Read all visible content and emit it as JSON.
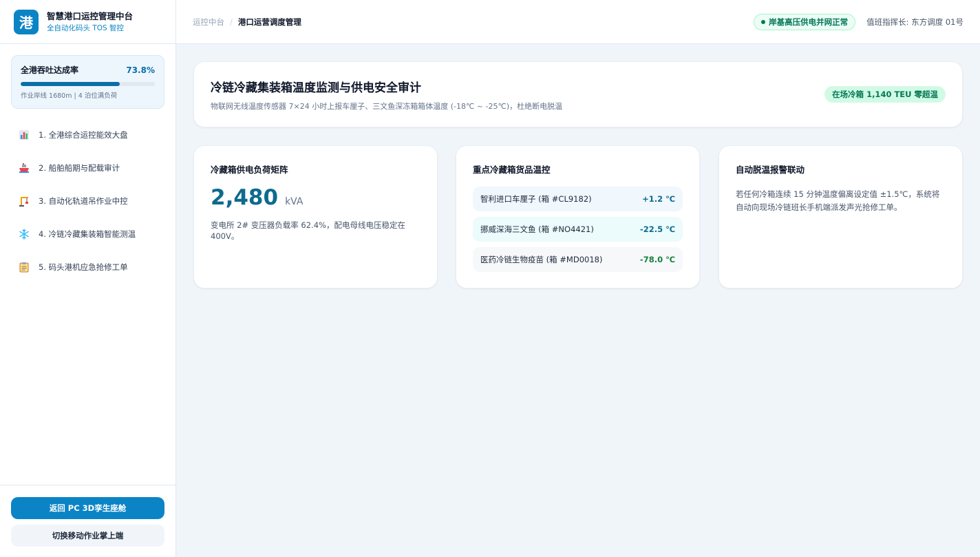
{
  "brand": {
    "logo": "港",
    "title": "智慧港口运控管理中台",
    "subtitle": "全自动化码头 TOS 智控"
  },
  "kpi": {
    "label": "全港吞吐达成率",
    "value": "73.8%",
    "progress": 73.8,
    "note": "作业岸线 1680m | 4 泊位满负荷"
  },
  "nav": [
    {
      "label": "1. 全港综合运控能效大盘",
      "icon": "bar-chart-icon"
    },
    {
      "label": "2. 船舶船期与配载审计",
      "icon": "ship-icon"
    },
    {
      "label": "3. 自动化轨道吊作业中控",
      "icon": "crane-icon"
    },
    {
      "label": "4. 冷链冷藏集装箱智能测温",
      "icon": "snowflake-icon"
    },
    {
      "label": "5. 码头港机应急抢修工单",
      "icon": "clipboard-icon"
    }
  ],
  "footer": {
    "primary": "返回 PC 3D孪生座舱",
    "secondary": "切换移动作业掌上端"
  },
  "header": {
    "crumb_root": "运控中台",
    "crumb_sep": "/",
    "crumb_current": "港口运营调度管理",
    "status": "岸基高压供电并网正常",
    "duty": "值班指挥长: 东方调度 01号"
  },
  "hero": {
    "title": "冷链冷藏集装箱温度监测与供电安全审计",
    "desc": "物联网无线温度传感器 7×24 小时上报车厘子、三文鱼深冻箱箱体温度 (-18℃ ~ -25℃)，杜绝断电脱温",
    "badge": "在场冷箱 1,140 TEU 零超温"
  },
  "power_card": {
    "title": "冷藏箱供电负荷矩阵",
    "value": "2,480",
    "unit": "kVA",
    "text": "变电所 2# 变压器负载率 62.4%，配电母线电压稳定在 400V。"
  },
  "temp_card": {
    "title": "重点冷藏箱货品温控",
    "rows": [
      {
        "name": "智利进口车厘子 (箱 #CL9182)",
        "value": "+1.2 ℃",
        "color": "#0e6a8f",
        "bg": "#f0f7fd"
      },
      {
        "name": "挪威深海三文鱼 (箱 #NO4421)",
        "value": "-22.5 ℃",
        "color": "#0e6a8f",
        "bg": "#ecfbfc"
      },
      {
        "name": "医药冷链生物疫苗 (箱 #MD0018)",
        "value": "-78.0 ℃",
        "color": "#15803d",
        "bg": "#f6f8fa"
      }
    ]
  },
  "alarm_card": {
    "title": "自动脱温报警联动",
    "text": "若任何冷箱连续 15 分钟温度偏离设定值 ±1.5℃，系统将自动向现场冷链班长手机端派发声光抢修工单。"
  }
}
